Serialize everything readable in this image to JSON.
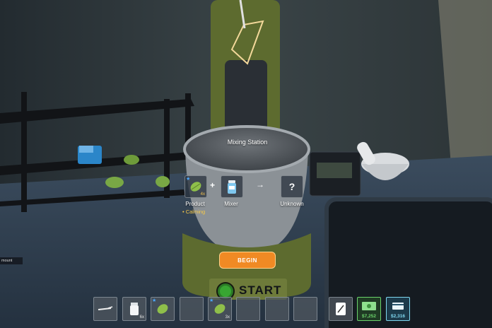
{
  "station": {
    "title": "Mixing Station",
    "product": {
      "label": "Product",
      "effect": "• Calming",
      "quantity": "4x"
    },
    "mixer": {
      "label": "Mixer"
    },
    "result": {
      "label": "Unknown",
      "symbol": "?"
    },
    "plus_symbol": "+",
    "arrow_symbol": "→",
    "begin_label": "BEGIN",
    "start_label": "START"
  },
  "side_tag": "mount",
  "hotbar": {
    "slots": [
      {
        "icon": "stick-icon",
        "qty": ""
      },
      {
        "icon": "jar-icon",
        "qty": "6x"
      },
      {
        "icon": "weed-bud-icon",
        "qty": ""
      },
      {
        "icon": "empty",
        "qty": ""
      },
      {
        "icon": "weed-bud-icon",
        "qty": "3x"
      },
      {
        "icon": "empty",
        "qty": ""
      },
      {
        "icon": "empty",
        "qty": ""
      },
      {
        "icon": "empty",
        "qty": ""
      }
    ],
    "phone_icon": "phone-icon",
    "cash": "$7,252",
    "bank": "$2,316"
  },
  "colors": {
    "accent_orange": "#f08a24",
    "cash_green": "#6bd36b",
    "bank_cyan": "#7fd8f0",
    "mixer_body": "#5d6b2f"
  }
}
